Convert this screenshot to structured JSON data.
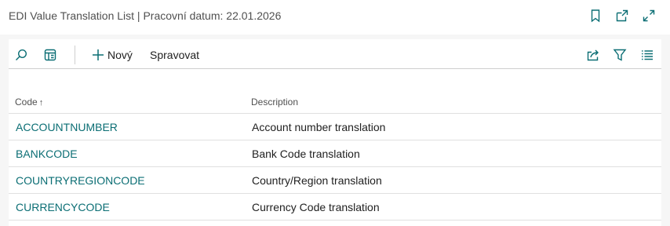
{
  "window": {
    "title": "EDI Value Translation List | Pracovní datum: 22.01.2026",
    "icons": [
      "bookmark-icon",
      "open-new-window-icon",
      "expand-icon"
    ]
  },
  "toolbar": {
    "search_icon": "search-icon",
    "view_icon": "view-layout-icon",
    "new_label": "Nový",
    "manage_label": "Spravovat",
    "right_icons": [
      "share-icon",
      "filter-icon",
      "list-view-icon"
    ]
  },
  "table": {
    "headers": {
      "code": "Code",
      "code_sort": "↑",
      "description": "Description"
    },
    "rows": [
      {
        "code": "ACCOUNTNUMBER",
        "description": "Account number translation"
      },
      {
        "code": "BANKCODE",
        "description": "Bank Code translation"
      },
      {
        "code": "COUNTRYREGIONCODE",
        "description": "Country/Region translation"
      },
      {
        "code": "CURRENCYCODE",
        "description": "Currency Code translation"
      }
    ]
  },
  "colors": {
    "accent": "#0b6e74",
    "icon": "#0b6e74",
    "text": "#212121",
    "muted": "#505050"
  }
}
